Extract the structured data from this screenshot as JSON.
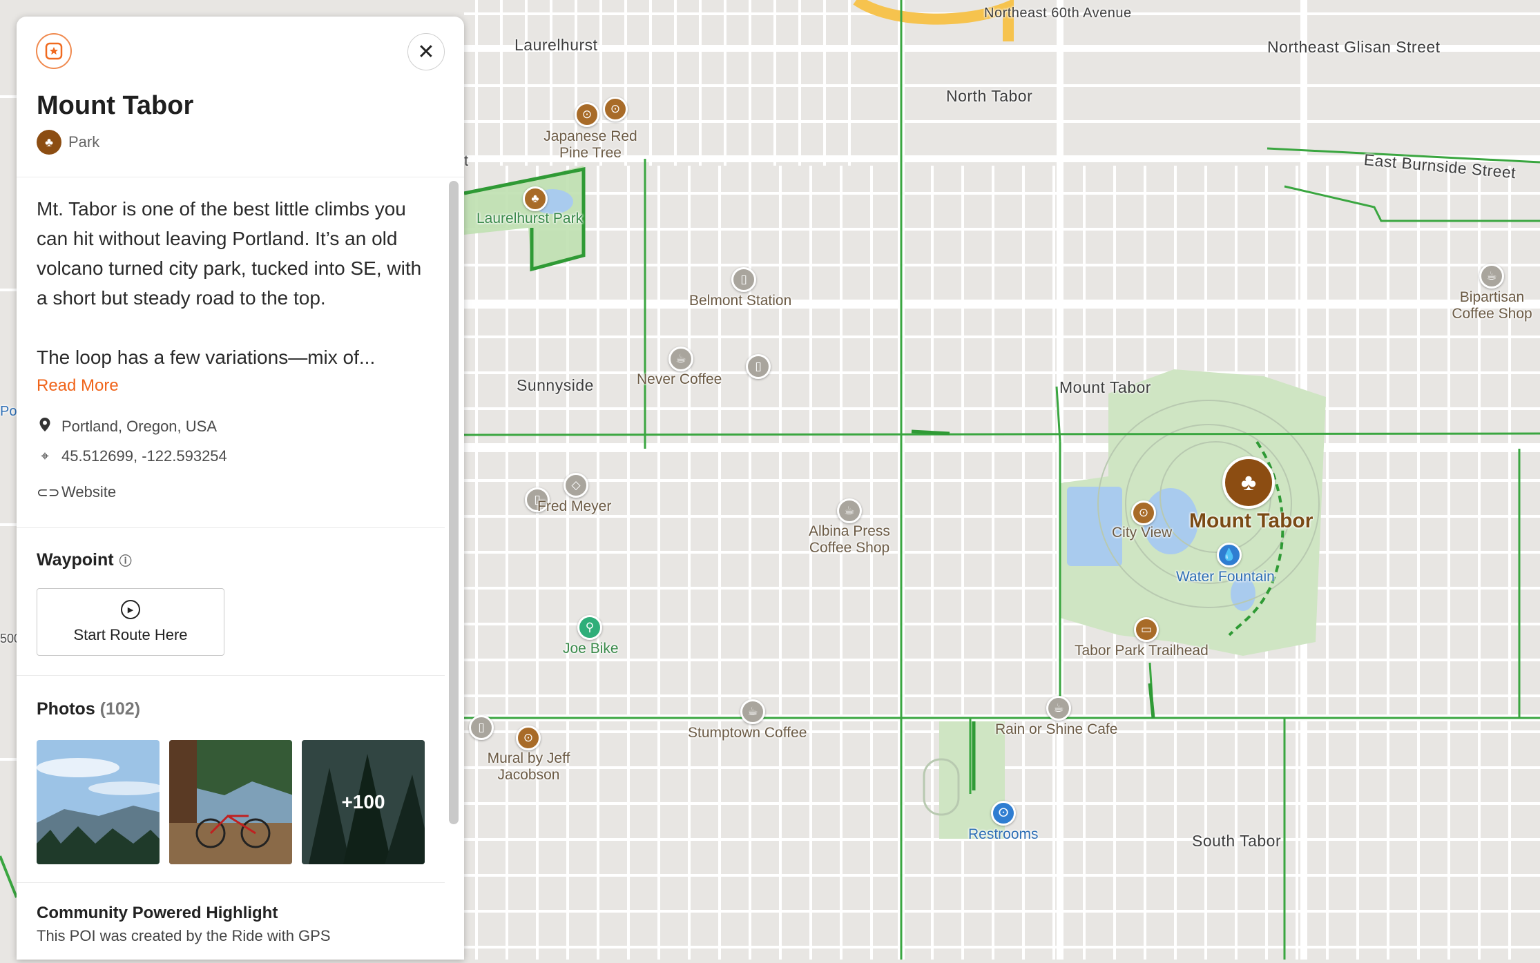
{
  "map": {
    "streets": [
      "Laurelhurst",
      "Northeast 60th Avenue",
      "Northeast Glisan Street",
      "North Tabor",
      "East Burnside Street",
      "Sunnyside",
      "Mount Tabor",
      "South Tabor"
    ],
    "pois": [
      {
        "label": "Japanese Red Pine Tree",
        "icon": "binoculars-icon"
      },
      {
        "label": "Laurelhurst Park",
        "icon": "tree-icon"
      },
      {
        "label": "Belmont Station",
        "icon": "beer-icon"
      },
      {
        "label": "Never Coffee",
        "icon": "coffee-icon"
      },
      {
        "label": "Fred Meyer",
        "icon": "shopping-icon"
      },
      {
        "label": "Albina Press Coffee Shop",
        "icon": "coffee-icon"
      },
      {
        "label": "Joe Bike",
        "icon": "bike-icon"
      },
      {
        "label": "Stumptown Coffee",
        "icon": "coffee-icon"
      },
      {
        "label": "Mural by Jeff Jacobson",
        "icon": "binoculars-icon"
      },
      {
        "label": "Rain or Shine Cafe",
        "icon": "coffee-icon"
      },
      {
        "label": "Restrooms",
        "icon": "restroom-icon"
      },
      {
        "label": "City View",
        "icon": "binoculars-icon"
      },
      {
        "label": "Water Fountain",
        "icon": "water-icon"
      },
      {
        "label": "Tabor Park Trailhead",
        "icon": "sign-icon"
      },
      {
        "label": "Bipartisan Coffee Shop",
        "icon": "coffee-icon"
      },
      {
        "label": "Mount Tabor",
        "icon": "tree-icon"
      }
    ],
    "edge_fragments": [
      "Po",
      "500",
      "t"
    ]
  },
  "panel": {
    "title": "Mount Tabor",
    "type": "Park",
    "description_p1": "Mt. Tabor is one of the best little climbs you can hit without leaving Portland. It’s an old volcano turned city park, tucked into SE, with a short but steady road to the top.",
    "description_p2": "The loop has a few variations—mix of...",
    "read_more": "Read More",
    "location": "Portland, Oregon, USA",
    "coordinates": "45.512699, -122.593254",
    "website": "Website",
    "waypoint_title": "Waypoint",
    "start_route": "Start Route Here",
    "photos_title": "Photos",
    "photos_count": "(102)",
    "photos_more": "+100",
    "community_title": "Community Powered Highlight",
    "community_text": "This POI was created by the Ride with GPS"
  },
  "colors": {
    "accent": "#f0641a",
    "park_icon": "#8c4d12",
    "bike_route": "#3aa640",
    "park_fill": "#cfe5c3",
    "water": "#a9cbee"
  }
}
